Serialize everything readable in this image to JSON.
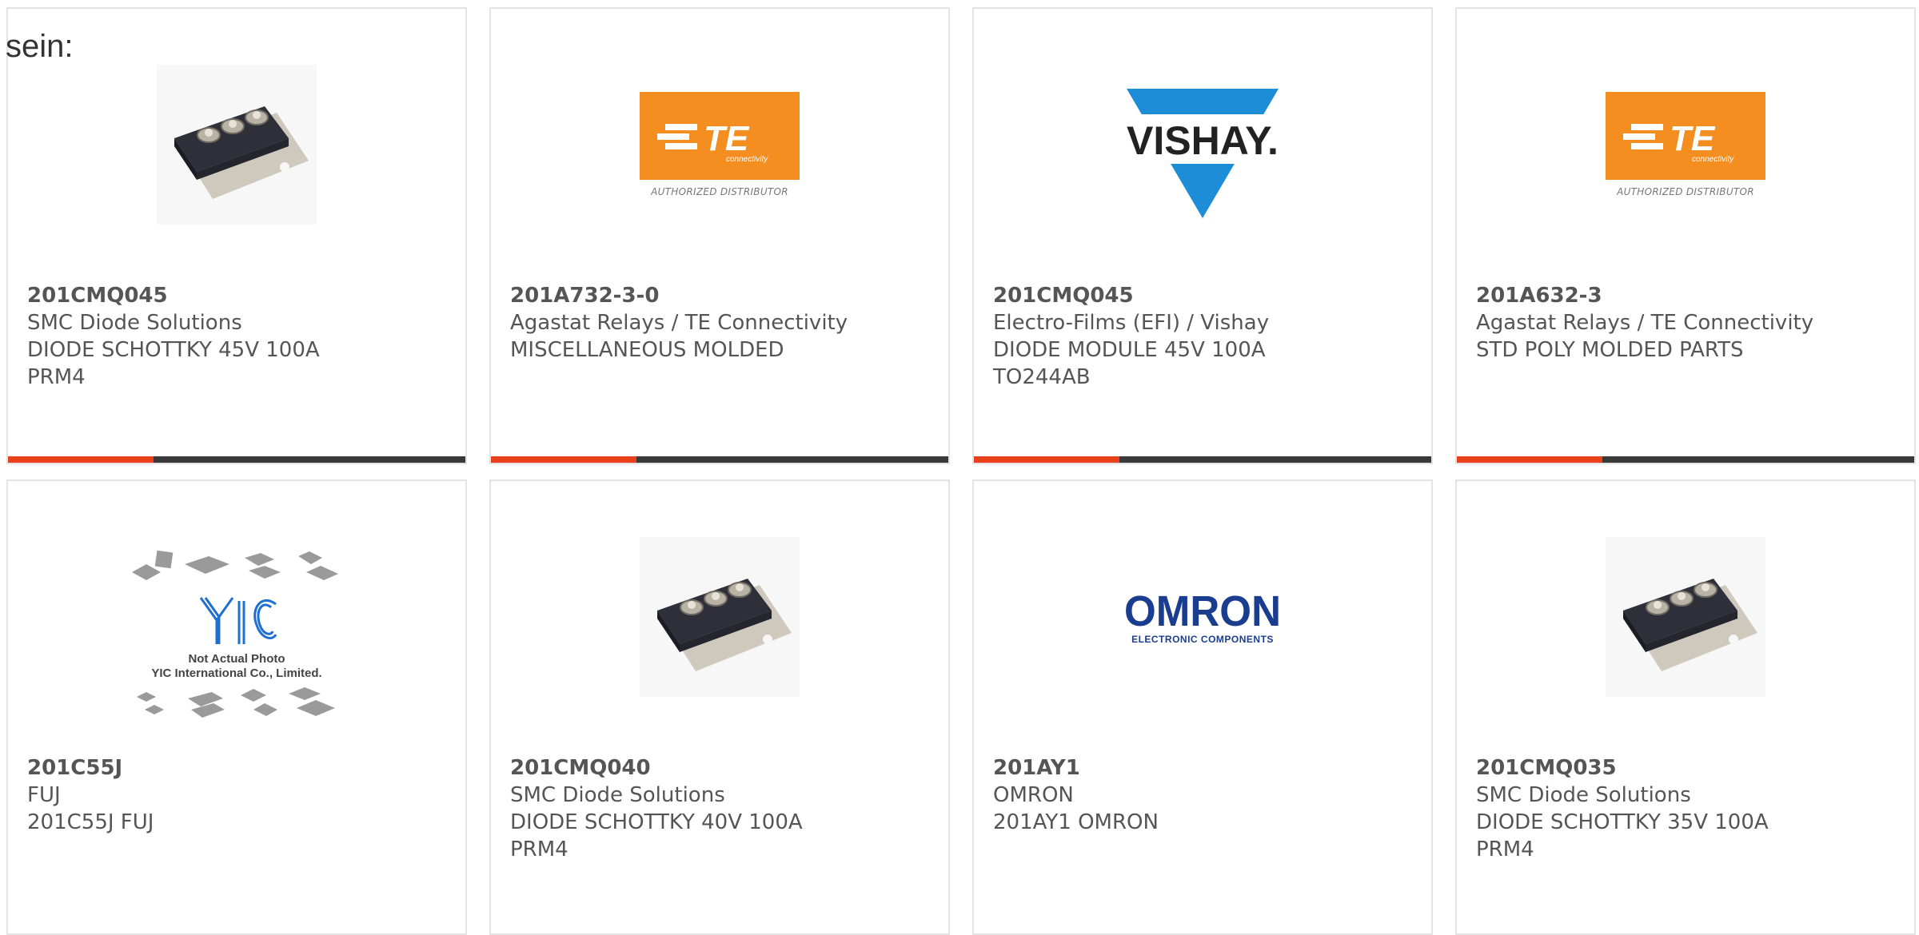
{
  "intro_text": "sein:",
  "colors": {
    "accent": "#e8411b",
    "bar": "#3a3a3a",
    "te_orange": "#f58e20",
    "vishay_blue": "#1c8dd6",
    "omron_blue": "#1a3d8f",
    "yic_blue": "#1f6fd1"
  },
  "cards": [
    {
      "part_number": "201CMQ045",
      "manufacturer": "SMC Diode Solutions",
      "desc1": "DIODE SCHOTTKY 45V 100A",
      "desc2": "PRM4",
      "image": "diode-module-photo"
    },
    {
      "part_number": "201A732-3-0",
      "manufacturer": "Agastat Relays / TE Connectivity",
      "desc1": "MISCELLANEOUS MOLDED",
      "desc2": "",
      "image": "te-logo",
      "logo_text": "TE",
      "logo_sub": "connectivity",
      "logo_caption": "AUTHORIZED DISTRIBUTOR"
    },
    {
      "part_number": "201CMQ045",
      "manufacturer": "Electro-Films (EFI) / Vishay",
      "desc1": "DIODE MODULE 45V 100A",
      "desc2": "TO244AB",
      "image": "vishay-logo",
      "logo_text": "VISHAY."
    },
    {
      "part_number": "201A632-3",
      "manufacturer": "Agastat Relays / TE Connectivity",
      "desc1": "STD POLY MOLDED PARTS",
      "desc2": "",
      "image": "te-logo",
      "logo_text": "TE",
      "logo_sub": "connectivity",
      "logo_caption": "AUTHORIZED DISTRIBUTOR"
    },
    {
      "part_number": "201C55J",
      "manufacturer": "FUJ",
      "desc1": "201C55J FUJ",
      "desc2": "",
      "image": "yic-placeholder",
      "logo_text": "YIC",
      "logo_line1": "Not Actual Photo",
      "logo_line2": "YIC International Co., Limited."
    },
    {
      "part_number": "201CMQ040",
      "manufacturer": "SMC Diode Solutions",
      "desc1": "DIODE SCHOTTKY 40V 100A",
      "desc2": "PRM4",
      "image": "diode-module-photo"
    },
    {
      "part_number": "201AY1",
      "manufacturer": "OMRON",
      "desc1": "201AY1 OMRON",
      "desc2": "",
      "image": "omron-logo",
      "logo_text": "OMRON",
      "logo_sub": "ELECTRONIC COMPONENTS"
    },
    {
      "part_number": "201CMQ035",
      "manufacturer": "SMC Diode Solutions",
      "desc1": "DIODE SCHOTTKY 35V 100A",
      "desc2": "PRM4",
      "image": "diode-module-photo"
    }
  ]
}
